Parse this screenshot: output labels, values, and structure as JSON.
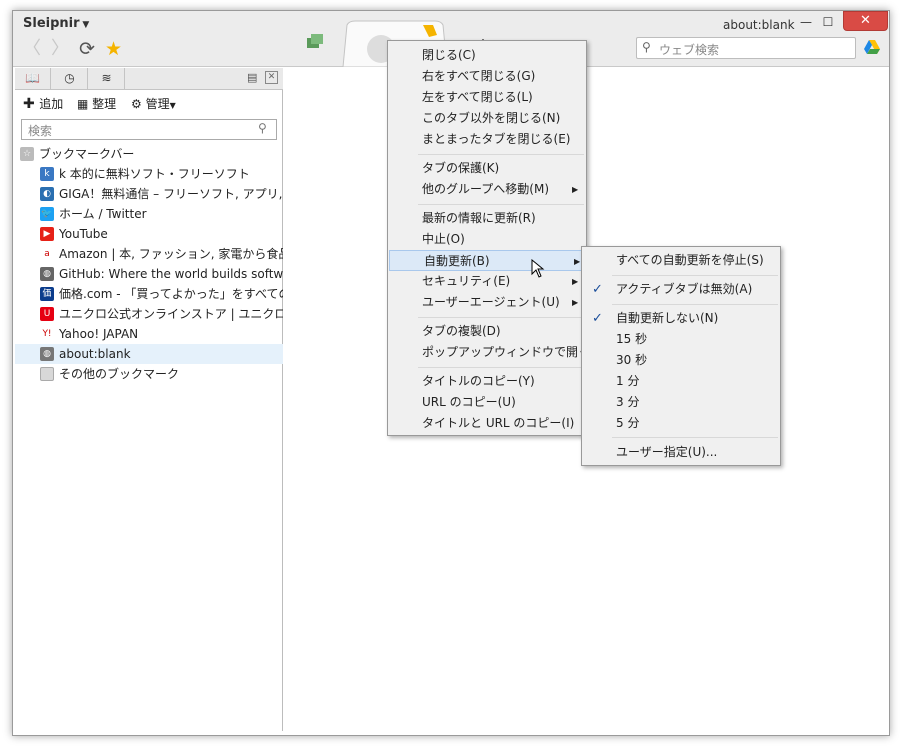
{
  "window": {
    "app_name": "Sleipnir",
    "title": "about:blank",
    "minimize": "—",
    "maximize": "☐",
    "close": "✕"
  },
  "toolbar": {
    "back": "〈",
    "forward": "〉",
    "reload": "⟳",
    "star": "★",
    "search_placeholder": "ウェブ検索"
  },
  "panel": {
    "tabs": [
      {
        "icon": "book-icon"
      },
      {
        "icon": "history-icon"
      },
      {
        "icon": "rss-icon"
      }
    ],
    "toolbar": {
      "add": "追加",
      "organize": "整理",
      "manage": "管理"
    },
    "search_placeholder": "検索",
    "root_folder": "ブックマークバー",
    "bookmarks": [
      {
        "title": "k 本的に無料ソフト・フリーソフト",
        "icon_color": "#3a78c3",
        "glyph": "k"
      },
      {
        "title": "GIGA！無料通信 – フリーソフト, アプリ, 無料の",
        "icon_color": "#2a6fb1",
        "glyph": "◐"
      },
      {
        "title": "ホーム / Twitter",
        "icon_color": "#1da1f2",
        "glyph": "🐦"
      },
      {
        "title": "YouTube",
        "icon_color": "#e62117",
        "glyph": "▶"
      },
      {
        "title": "Amazon | 本, ファッション, 家電から食品まで |",
        "icon_color": "#ffffff",
        "glyph": "a"
      },
      {
        "title": "GitHub: Where the world builds software ·",
        "icon_color": "#666666",
        "glyph": "◍"
      },
      {
        "title": "価格.com - 「買ってよかった」をすべてのひとに。",
        "icon_color": "#0b3c8c",
        "glyph": "価"
      },
      {
        "title": "ユニクロ公式オンラインストア | ユニクロ",
        "icon_color": "#e60012",
        "glyph": "U"
      },
      {
        "title": "Yahoo! JAPAN",
        "icon_color": "#ffffff",
        "glyph": "Y!"
      },
      {
        "title": "about:blank",
        "icon_color": "#777777",
        "glyph": "◍"
      }
    ],
    "other_folder": "その他のブックマーク"
  },
  "context_menu": {
    "groups": [
      [
        "閉じる(C)",
        "右をすべて閉じる(G)",
        "左をすべて閉じる(L)",
        "このタブ以外を閉じる(N)",
        "まとまったタブを閉じる(E)"
      ],
      [
        "タブの保護(K)",
        "他のグループへ移動(M)"
      ],
      [
        "最新の情報に更新(R)",
        "中止(O)",
        "自動更新(B)",
        "セキュリティ(E)",
        "ユーザーエージェント(U)"
      ],
      [
        "タブの複製(D)",
        "ポップアップウィンドウで開く(S)"
      ],
      [
        "タイトルのコピー(Y)",
        "URL のコピー(U)",
        "タイトルと URL のコピー(I)"
      ]
    ],
    "arrow": "▶"
  },
  "submenu": {
    "items": [
      "すべての自動更新を停止(S)",
      "アクティブタブは無効(A)",
      "自動更新しない(N)",
      "15 秒",
      "30 秒",
      "1 分",
      "3 分",
      "5 分",
      "ユーザー指定(U)..."
    ],
    "checkmark": "✓"
  }
}
